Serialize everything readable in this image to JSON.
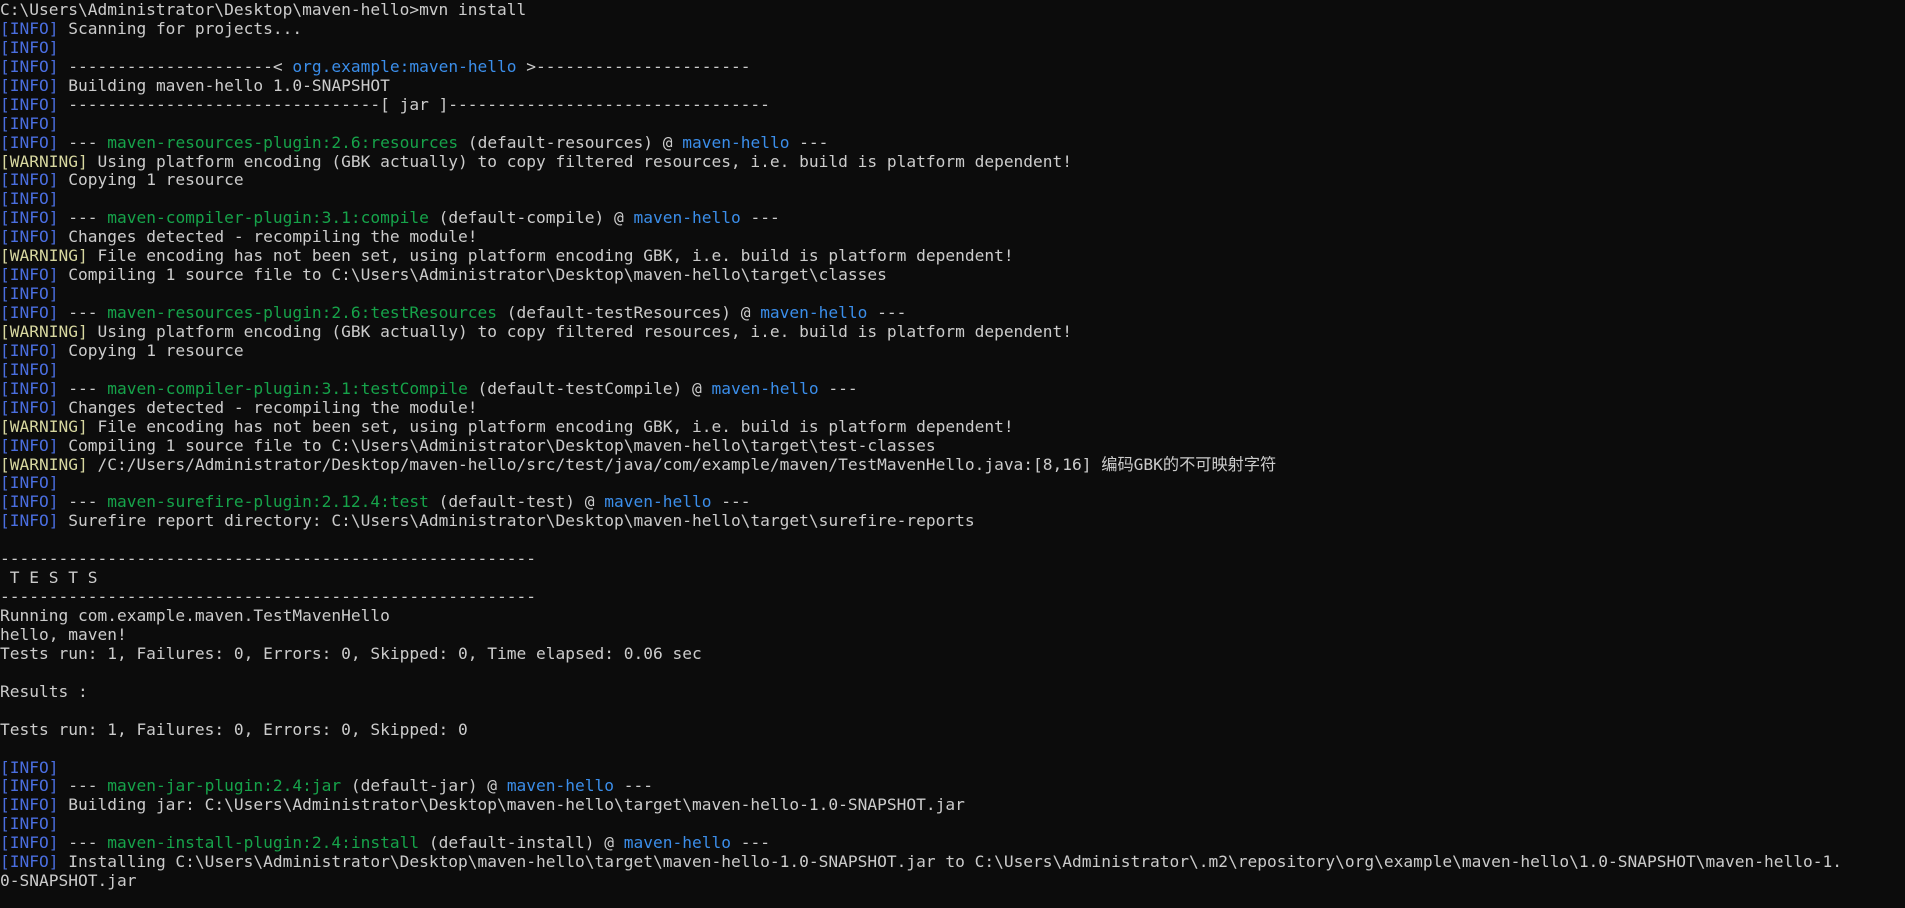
{
  "theme": {
    "background": "#0c0c0c",
    "foreground": "#cccccc",
    "info": "#4a6ee0",
    "warning": "#d7d7a0",
    "plugin": "#16a34a",
    "project": "#3b8eea"
  },
  "lines": [
    [
      {
        "t": "C:\\Users\\Administrator\\Desktop\\maven-hello>mvn install"
      }
    ],
    [
      {
        "t": "[INFO]",
        "c": "info"
      },
      {
        "t": " Scanning for projects..."
      }
    ],
    [
      {
        "t": "[INFO]",
        "c": "info"
      }
    ],
    [
      {
        "t": "[INFO]",
        "c": "info"
      },
      {
        "t": " ---------------------< "
      },
      {
        "t": "org.example:maven-hello",
        "c": "project"
      },
      {
        "t": " >----------------------"
      }
    ],
    [
      {
        "t": "[INFO]",
        "c": "info"
      },
      {
        "t": " Building maven-hello 1.0-SNAPSHOT"
      }
    ],
    [
      {
        "t": "[INFO]",
        "c": "info"
      },
      {
        "t": " --------------------------------[ jar ]---------------------------------"
      }
    ],
    [
      {
        "t": "[INFO]",
        "c": "info"
      }
    ],
    [
      {
        "t": "[INFO]",
        "c": "info"
      },
      {
        "t": " --- "
      },
      {
        "t": "maven-resources-plugin:2.6:resources",
        "c": "plugin"
      },
      {
        "t": " (default-resources) @ "
      },
      {
        "t": "maven-hello",
        "c": "project"
      },
      {
        "t": " ---"
      }
    ],
    [
      {
        "t": "[WARNING]",
        "c": "warn"
      },
      {
        "t": " Using platform encoding (GBK actually) to copy filtered resources, i.e. build is platform dependent!"
      }
    ],
    [
      {
        "t": "[INFO]",
        "c": "info"
      },
      {
        "t": " Copying 1 resource"
      }
    ],
    [
      {
        "t": "[INFO]",
        "c": "info"
      }
    ],
    [
      {
        "t": "[INFO]",
        "c": "info"
      },
      {
        "t": " --- "
      },
      {
        "t": "maven-compiler-plugin:3.1:compile",
        "c": "plugin"
      },
      {
        "t": " (default-compile) @ "
      },
      {
        "t": "maven-hello",
        "c": "project"
      },
      {
        "t": " ---"
      }
    ],
    [
      {
        "t": "[INFO]",
        "c": "info"
      },
      {
        "t": " Changes detected - recompiling the module!"
      }
    ],
    [
      {
        "t": "[WARNING]",
        "c": "warn"
      },
      {
        "t": " File encoding has not been set, using platform encoding GBK, i.e. build is platform dependent!"
      }
    ],
    [
      {
        "t": "[INFO]",
        "c": "info"
      },
      {
        "t": " Compiling 1 source file to C:\\Users\\Administrator\\Desktop\\maven-hello\\target\\classes"
      }
    ],
    [
      {
        "t": "[INFO]",
        "c": "info"
      }
    ],
    [
      {
        "t": "[INFO]",
        "c": "info"
      },
      {
        "t": " --- "
      },
      {
        "t": "maven-resources-plugin:2.6:testResources",
        "c": "plugin"
      },
      {
        "t": " (default-testResources) @ "
      },
      {
        "t": "maven-hello",
        "c": "project"
      },
      {
        "t": " ---"
      }
    ],
    [
      {
        "t": "[WARNING]",
        "c": "warn"
      },
      {
        "t": " Using platform encoding (GBK actually) to copy filtered resources, i.e. build is platform dependent!"
      }
    ],
    [
      {
        "t": "[INFO]",
        "c": "info"
      },
      {
        "t": " Copying 1 resource"
      }
    ],
    [
      {
        "t": "[INFO]",
        "c": "info"
      }
    ],
    [
      {
        "t": "[INFO]",
        "c": "info"
      },
      {
        "t": " --- "
      },
      {
        "t": "maven-compiler-plugin:3.1:testCompile",
        "c": "plugin"
      },
      {
        "t": " (default-testCompile) @ "
      },
      {
        "t": "maven-hello",
        "c": "project"
      },
      {
        "t": " ---"
      }
    ],
    [
      {
        "t": "[INFO]",
        "c": "info"
      },
      {
        "t": " Changes detected - recompiling the module!"
      }
    ],
    [
      {
        "t": "[WARNING]",
        "c": "warn"
      },
      {
        "t": " File encoding has not been set, using platform encoding GBK, i.e. build is platform dependent!"
      }
    ],
    [
      {
        "t": "[INFO]",
        "c": "info"
      },
      {
        "t": " Compiling 1 source file to C:\\Users\\Administrator\\Desktop\\maven-hello\\target\\test-classes"
      }
    ],
    [
      {
        "t": "[WARNING]",
        "c": "warn"
      },
      {
        "t": " /C:/Users/Administrator/Desktop/maven-hello/src/test/java/com/example/maven/TestMavenHello.java:[8,16] 编码GBK的不可映射字符"
      }
    ],
    [
      {
        "t": "[INFO]",
        "c": "info"
      }
    ],
    [
      {
        "t": "[INFO]",
        "c": "info"
      },
      {
        "t": " --- "
      },
      {
        "t": "maven-surefire-plugin:2.12.4:test",
        "c": "plugin"
      },
      {
        "t": " (default-test) @ "
      },
      {
        "t": "maven-hello",
        "c": "project"
      },
      {
        "t": " ---"
      }
    ],
    [
      {
        "t": "[INFO]",
        "c": "info"
      },
      {
        "t": " Surefire report directory: C:\\Users\\Administrator\\Desktop\\maven-hello\\target\\surefire-reports"
      }
    ],
    [],
    [
      {
        "t": "-------------------------------------------------------"
      }
    ],
    [
      {
        "t": " T E S T S"
      }
    ],
    [
      {
        "t": "-------------------------------------------------------"
      }
    ],
    [
      {
        "t": "Running com.example.maven.TestMavenHello"
      }
    ],
    [
      {
        "t": "hello, maven!"
      }
    ],
    [
      {
        "t": "Tests run: 1, Failures: 0, Errors: 0, Skipped: 0, Time elapsed: 0.06 sec"
      }
    ],
    [],
    [
      {
        "t": "Results :"
      }
    ],
    [],
    [
      {
        "t": "Tests run: 1, Failures: 0, Errors: 0, Skipped: 0"
      }
    ],
    [],
    [
      {
        "t": "[INFO]",
        "c": "info"
      }
    ],
    [
      {
        "t": "[INFO]",
        "c": "info"
      },
      {
        "t": " --- "
      },
      {
        "t": "maven-jar-plugin:2.4:jar",
        "c": "plugin"
      },
      {
        "t": " (default-jar) @ "
      },
      {
        "t": "maven-hello",
        "c": "project"
      },
      {
        "t": " ---"
      }
    ],
    [
      {
        "t": "[INFO]",
        "c": "info"
      },
      {
        "t": " Building jar: C:\\Users\\Administrator\\Desktop\\maven-hello\\target\\maven-hello-1.0-SNAPSHOT.jar"
      }
    ],
    [
      {
        "t": "[INFO]",
        "c": "info"
      }
    ],
    [
      {
        "t": "[INFO]",
        "c": "info"
      },
      {
        "t": " --- "
      },
      {
        "t": "maven-install-plugin:2.4:install",
        "c": "plugin"
      },
      {
        "t": " (default-install) @ "
      },
      {
        "t": "maven-hello",
        "c": "project"
      },
      {
        "t": " ---"
      }
    ],
    [
      {
        "t": "[INFO]",
        "c": "info"
      },
      {
        "t": " Installing C:\\Users\\Administrator\\Desktop\\maven-hello\\target\\maven-hello-1.0-SNAPSHOT.jar to C:\\Users\\Administrator\\.m2\\repository\\org\\example\\maven-hello\\1.0-SNAPSHOT\\maven-hello-1."
      }
    ],
    [
      {
        "t": "0-SNAPSHOT.jar"
      }
    ]
  ]
}
